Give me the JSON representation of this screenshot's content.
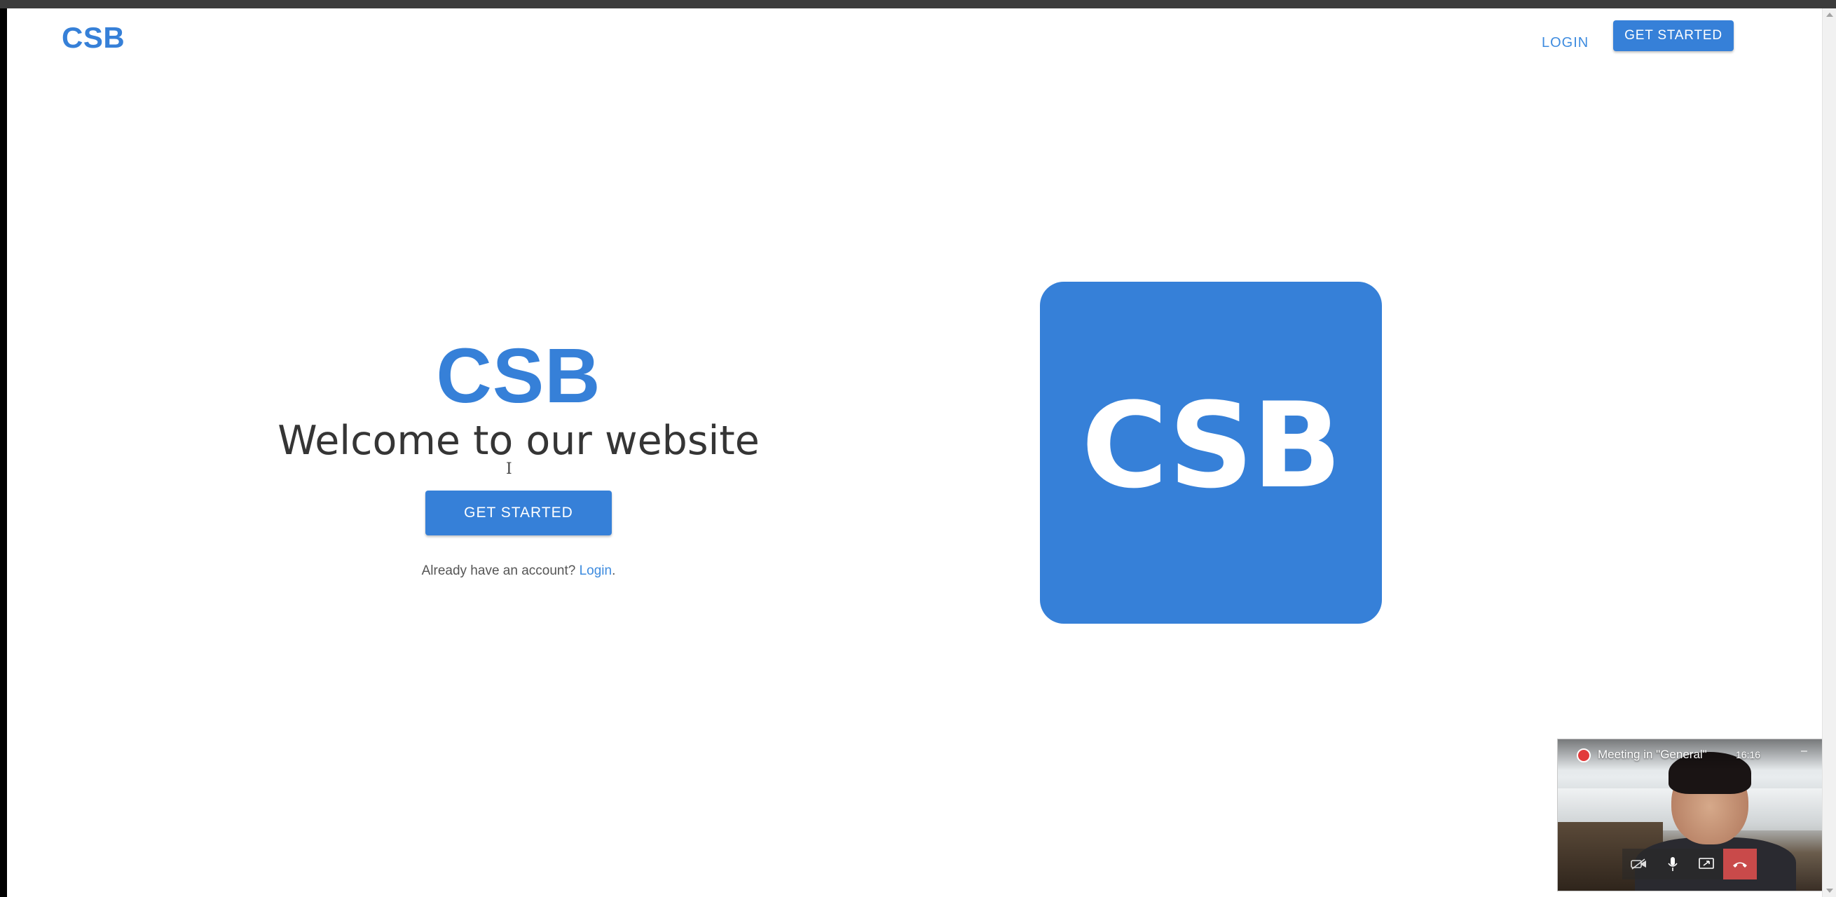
{
  "header": {
    "logo": "CSB",
    "login_label": "LOGIN",
    "get_started_label": "GET STARTED"
  },
  "hero": {
    "logo": "CSB",
    "title": "Welcome to our website",
    "cta_label": "GET STARTED",
    "login_prompt": "Already have an account?",
    "login_link": "Login",
    "login_suffix": "."
  },
  "logo_square": {
    "text": "CSB"
  },
  "meeting": {
    "title": "Meeting in \"General\"",
    "time": "16:16",
    "minimize": "–",
    "controls": [
      "camera-off-icon",
      "microphone-icon",
      "screen-share-icon",
      "hang-up-icon"
    ]
  },
  "colors": {
    "brand": "#3680d8",
    "link": "#3d8bdf",
    "hangup": "#c94a4a"
  }
}
